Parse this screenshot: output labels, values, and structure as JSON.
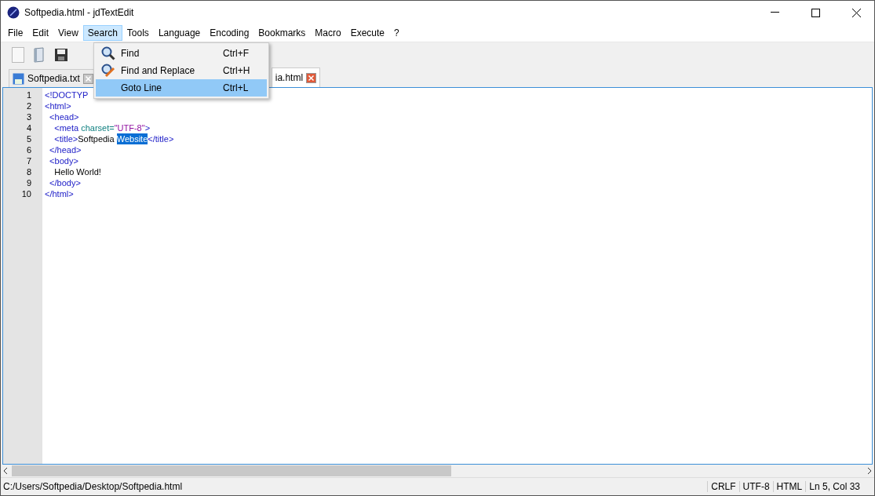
{
  "window": {
    "title": "Softpedia.html - jdTextEdit"
  },
  "menu_bar": [
    {
      "label": "File",
      "selected": false
    },
    {
      "label": "Edit",
      "selected": false
    },
    {
      "label": "View",
      "selected": false
    },
    {
      "label": "Search",
      "selected": true
    },
    {
      "label": "Tools",
      "selected": false
    },
    {
      "label": "Language",
      "selected": false
    },
    {
      "label": "Encoding",
      "selected": false
    },
    {
      "label": "Bookmarks",
      "selected": false
    },
    {
      "label": "Macro",
      "selected": false
    },
    {
      "label": "Execute",
      "selected": false
    },
    {
      "label": "?",
      "selected": false
    }
  ],
  "toolbar": [
    {
      "kind": "new"
    },
    {
      "kind": "open"
    },
    {
      "kind": "save"
    }
  ],
  "tabs": [
    {
      "label": "Softpedia.txt",
      "selected": false
    },
    {
      "label": "ia.html",
      "selected": true
    }
  ],
  "dropdown": [
    {
      "kind": "find",
      "label": "Find",
      "shortcut": "Ctrl+F",
      "selected": false
    },
    {
      "kind": "replace",
      "label": "Find and Replace",
      "shortcut": "Ctrl+H",
      "selected": false
    },
    {
      "kind": "plain",
      "label": "Goto Line",
      "shortcut": "Ctrl+L",
      "selected": true
    }
  ],
  "editor": {
    "lines": [
      {
        "number": "1",
        "segments": [
          {
            "kind": "tag",
            "text": "<!DOCTYP",
            "selected": false
          }
        ]
      },
      {
        "number": "2",
        "segments": [
          {
            "kind": "tag",
            "text": "<html>",
            "selected": false
          }
        ]
      },
      {
        "number": "3",
        "segments": [
          {
            "kind": "tag",
            "text": "  <head>",
            "selected": false
          }
        ]
      },
      {
        "number": "4",
        "segments": [
          {
            "kind": "tag",
            "text": "    <meta ",
            "selected": false
          },
          {
            "kind": "attr",
            "text": "charset=",
            "selected": false
          },
          {
            "kind": "value",
            "text": "\"UTF-8\"",
            "selected": false
          },
          {
            "kind": "tag",
            "text": ">",
            "selected": false
          }
        ]
      },
      {
        "number": "5",
        "segments": [
          {
            "kind": "tag",
            "text": "    <title>",
            "selected": false
          },
          {
            "kind": "text",
            "text": "Softpedia ",
            "selected": false
          },
          {
            "kind": "text",
            "text": "Website",
            "selected": true
          },
          {
            "kind": "tag",
            "text": "</title>",
            "selected": false
          }
        ]
      },
      {
        "number": "6",
        "segments": [
          {
            "kind": "tag",
            "text": "  </head>",
            "selected": false
          }
        ]
      },
      {
        "number": "7",
        "segments": [
          {
            "kind": "tag",
            "text": "  <body>",
            "selected": false
          }
        ]
      },
      {
        "number": "8",
        "segments": [
          {
            "kind": "text",
            "text": "    Hello World!",
            "selected": false
          }
        ]
      },
      {
        "number": "9",
        "segments": [
          {
            "kind": "tag",
            "text": "  </body>",
            "selected": false
          }
        ]
      },
      {
        "number": "10",
        "segments": [
          {
            "kind": "tag",
            "text": "</html>",
            "selected": false
          }
        ]
      }
    ]
  },
  "status_bar": {
    "path": "C:/Users/Softpedia/Desktop/Softpedia.html",
    "fields": [
      "CRLF",
      "UTF-8",
      "HTML",
      "Ln 5, Col 33"
    ]
  }
}
